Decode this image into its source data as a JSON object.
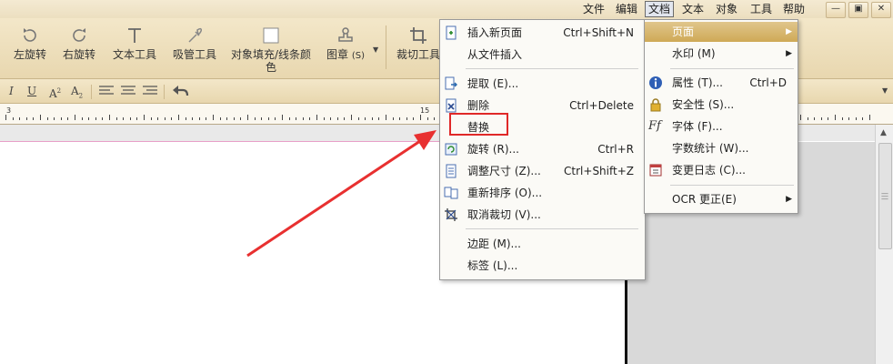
{
  "menubar": {
    "items": [
      {
        "id": "file",
        "label": "文件"
      },
      {
        "id": "edit",
        "label": "编辑"
      },
      {
        "id": "document",
        "label": "文档"
      },
      {
        "id": "text",
        "label": "文本"
      },
      {
        "id": "object",
        "label": "对象"
      },
      {
        "id": "tools",
        "label": "工具"
      },
      {
        "id": "help",
        "label": "帮助"
      }
    ],
    "active": "document"
  },
  "toolbar": {
    "rotate_left": "左旋转",
    "rotate_right": "右旋转",
    "text_tool": "文本工具",
    "eyedropper": "吸管工具",
    "fill_stroke_line1": "对象填充/线条颜",
    "fill_stroke_line2": "色",
    "stamp": "图章",
    "stamp_key": "(S)",
    "crop": "裁切工具"
  },
  "formatbar": {
    "italic": "I",
    "underline": "U",
    "superscript": "A",
    "subscript": "A"
  },
  "ruler": {
    "numbers": [
      "3",
      "",
      "",
      "",
      "",
      "",
      "",
      "",
      "",
      "",
      "",
      "",
      "",
      "",
      "",
      "15"
    ]
  },
  "document_menu": {
    "items": [
      {
        "label": "插入新页面",
        "shortcut": "Ctrl+Shift+N",
        "icon": "insert-page-icon"
      },
      {
        "label": "从文件插入",
        "shortcut": "",
        "icon": ""
      },
      {
        "label": "提取 (E)...",
        "shortcut": "",
        "icon": "extract-icon"
      },
      {
        "label": "删除",
        "shortcut": "Ctrl+Delete",
        "icon": "delete-page-icon"
      },
      {
        "label": "替换",
        "shortcut": "",
        "icon": ""
      },
      {
        "label": "旋转 (R)...",
        "shortcut": "Ctrl+R",
        "icon": "rotate-page-icon"
      },
      {
        "label": "调整尺寸 (Z)...",
        "shortcut": "Ctrl+Shift+Z",
        "icon": "resize-icon"
      },
      {
        "label": "重新排序 (O)...",
        "shortcut": "",
        "icon": "reorder-icon"
      },
      {
        "label": "取消裁切 (V)...",
        "shortcut": "",
        "icon": "uncrop-icon"
      },
      {
        "label": "边距 (M)...",
        "shortcut": "",
        "icon": ""
      },
      {
        "label": "标签 (L)...",
        "shortcut": "",
        "icon": ""
      }
    ]
  },
  "submenu": {
    "items": [
      {
        "label": "页面",
        "shortcut": "",
        "icon": "",
        "arrow": true
      },
      {
        "label": "水印 (M)",
        "shortcut": "",
        "icon": "",
        "arrow": true
      },
      {
        "label": "属性 (T)...",
        "shortcut": "Ctrl+D",
        "icon": "info-icon",
        "arrow": false
      },
      {
        "label": "安全性 (S)...",
        "shortcut": "",
        "icon": "lock-icon",
        "arrow": false
      },
      {
        "label": "字体 (F)...",
        "shortcut": "",
        "icon": "font-icon",
        "arrow": false
      },
      {
        "label": "字数统计 (W)...",
        "shortcut": "",
        "icon": "",
        "arrow": false
      },
      {
        "label": "变更日志 (C)...",
        "shortcut": "",
        "icon": "changelog-icon",
        "arrow": false
      },
      {
        "label": "OCR 更正(E)",
        "shortcut": "",
        "icon": "",
        "arrow": true
      }
    ]
  },
  "colors": {
    "highlight": "#d4ae5e",
    "annotation_red": "#e02828",
    "toolbar_bg": "#efe2c2"
  }
}
